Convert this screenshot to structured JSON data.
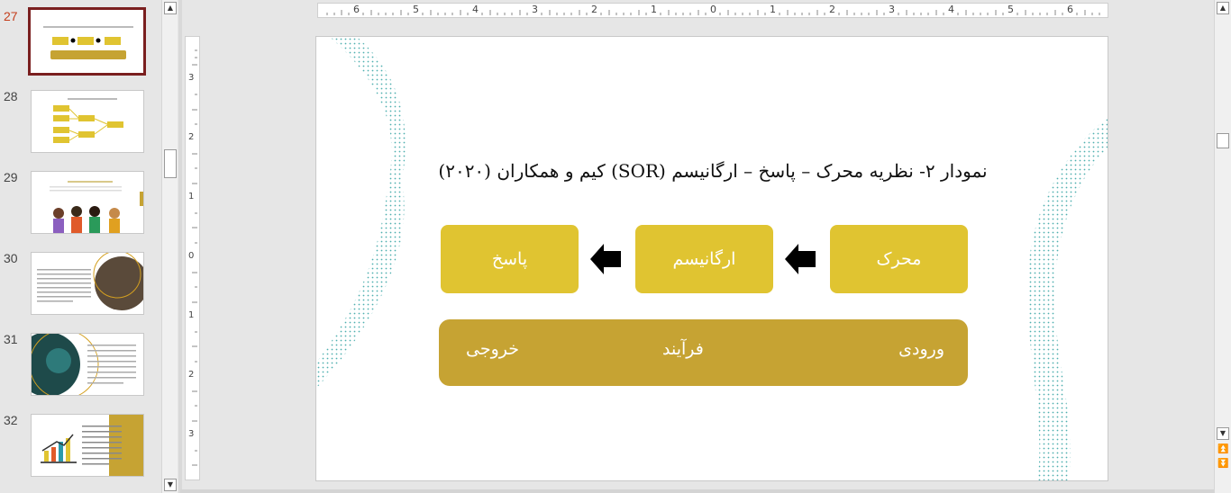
{
  "thumbnails": [
    {
      "number": "27",
      "active": true
    },
    {
      "number": "28",
      "active": false
    },
    {
      "number": "29",
      "active": false
    },
    {
      "number": "30",
      "active": false
    },
    {
      "number": "31",
      "active": false
    },
    {
      "number": "32",
      "active": false
    }
  ],
  "ruler": {
    "horizontal_labels": [
      "6",
      "5",
      "4",
      "3",
      "2",
      "1",
      "0",
      "1",
      "2",
      "3",
      "4",
      "5",
      "6"
    ],
    "vertical_labels": [
      "3",
      "2",
      "1",
      "0",
      "1",
      "2",
      "3"
    ]
  },
  "slide": {
    "title": "نمودار ۲- نظریه محرک – پاسخ – ارگانیسم (SOR) کیم و همکاران (۲۰۲۰)",
    "boxes": {
      "stimulus": "محرک",
      "organism": "ارگانیسم",
      "response": "پاسخ"
    },
    "band": {
      "input": "ورودی",
      "process": "فرآیند",
      "output": "خروجی"
    },
    "colors": {
      "box": "#e0c431",
      "band": "#c6a333",
      "dots": "#3aa6a6"
    }
  },
  "icons": {
    "scroll_up": "▲",
    "scroll_down": "▼",
    "prev_slide": "⏫",
    "next_slide": "⏬"
  }
}
